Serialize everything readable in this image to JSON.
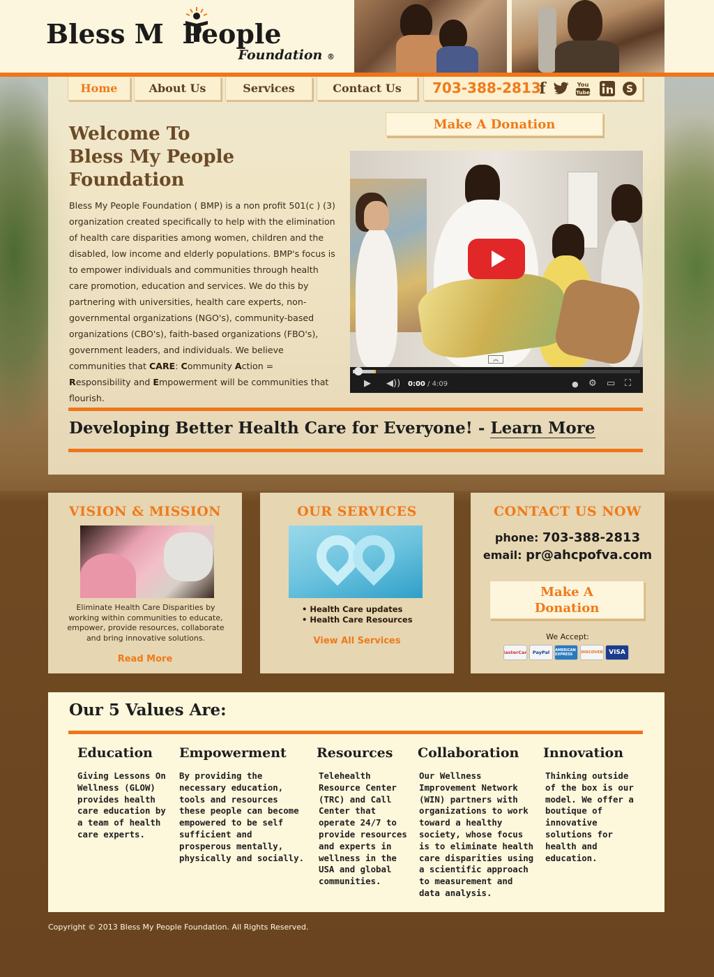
{
  "brand": {
    "name_line1": "Bless M  People",
    "name_line2": "Foundation",
    "registered": "®"
  },
  "nav": {
    "items": [
      {
        "label": "Home",
        "active": true
      },
      {
        "label": "About Us",
        "active": false
      },
      {
        "label": "Services",
        "active": false
      },
      {
        "label": "Contact Us",
        "active": false
      }
    ],
    "phone": "703-388-2813",
    "social_icons": [
      "facebook-icon",
      "twitter-icon",
      "youtube-icon",
      "linkedin-icon",
      "skype-icon"
    ]
  },
  "hero": {
    "donate_label": "Make A Donation",
    "title_line1": "Welcome To",
    "title_line2": "Bless My People",
    "title_line3": "Foundation",
    "intro": "Bless My People Foundation ( BMP) is a non profit 501(c ) (3) organization created specifically to help with the elimination of health care disparities among women, children and the disabled, low income and elderly populations. BMP's focus is to empower individuals and communities through health care promotion, education and services. We do this by partnering with universities, health care experts, non-governmental organizations (NGO's), community-based organizations (CBO's), faith-based organizations (FBO's), government leaders, and individuals. We believe communities that ",
    "care_bold": "CARE",
    "care_c": "C",
    "care_ommunity": "ommunity ",
    "care_a": "A",
    "care_ction": "ction = ",
    "care_r": "R",
    "care_esponsibility": "esponsibility and ",
    "care_e": "E",
    "care_end": "mpowerment will be communities that flourish.",
    "video": {
      "time_current": "0:00",
      "time_total": " / 4:09"
    }
  },
  "tagline": {
    "text": "Developing Better Health Care for Everyone! - ",
    "link": "Learn More"
  },
  "cards": {
    "vision": {
      "title": "VISION & MISSION",
      "text": "Eliminate Health Care Disparities by working within communities to educate, empower, provide resources, collaborate and bring innovative solutions.",
      "link": "Read More"
    },
    "services": {
      "title": "OUR SERVICES",
      "items": [
        "• Health Care updates",
        "• Health Care Resources"
      ],
      "link": "View All Services"
    },
    "contact": {
      "title": "CONTACT US NOW",
      "phone_label": "phone: ",
      "phone": "703-388-2813",
      "email_label": "email: ",
      "email": "pr@ahcpofva.com",
      "donate_line1": "Make A",
      "donate_line2": "Donation",
      "accept_label": "We Accept:",
      "payment_methods": [
        "MasterCard",
        "PayPal",
        "AMERICAN EXPRESS",
        "DISCOVER",
        "VISA"
      ]
    }
  },
  "values": {
    "title": "Our 5 Values Are:",
    "items": [
      {
        "heading": "Education",
        "text": "Giving Lessons On Wellness (GLOW) provides health care education by a team of health care experts."
      },
      {
        "heading": "Empowerment",
        "text": "By providing the necessary education, tools and resources these people can become empowered to be self sufficient and prosperous mentally, physically and socially."
      },
      {
        "heading": "Resources",
        "text": "Telehealth Resource Center (TRC) and Call Center that operate 24/7 to provide resources and experts in wellness in the USA and global communities."
      },
      {
        "heading": "Collaboration",
        "text": "Our Wellness Improvement Network (WIN) partners with organizations to work toward a healthy society, whose focus is to eliminate health care disparities using a scientific approach to measurement and data analysis."
      },
      {
        "heading": "Innovation",
        "text": "Thinking outside of the box is our model. We offer a boutique of innovative solutions for health and education."
      }
    ]
  },
  "footer": {
    "copyright": "Copyright © 2013 Bless My People Foundation. All Rights Reserved."
  },
  "colors": {
    "accent": "#f07519",
    "brown": "#6b4a26",
    "cream": "#fdf7dc"
  }
}
